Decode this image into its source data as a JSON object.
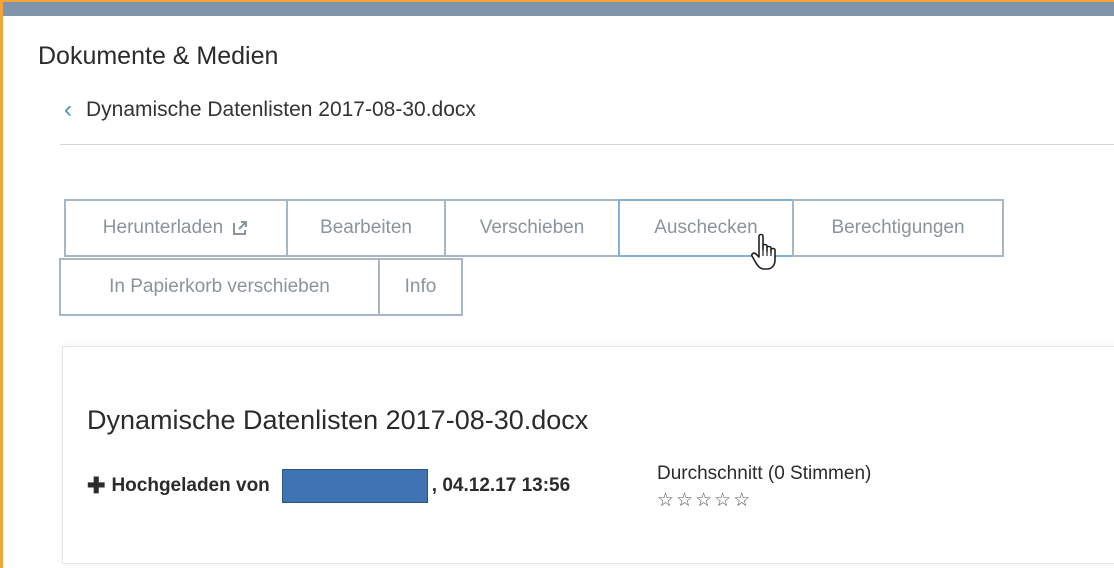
{
  "portlet": {
    "title": "Dokumente & Medien"
  },
  "navigation": {
    "back_label": "Dynamische Datenlisten 2017-08-30.docx"
  },
  "actions": {
    "row1": [
      "Herunterladen",
      "Bearbeiten",
      "Verschieben",
      "Auschecken",
      "Berechtigungen"
    ],
    "row2": [
      "In Papierkorb verschieben",
      "Info"
    ],
    "hovered": "Auschecken"
  },
  "document": {
    "title": "Dynamische Datenlisten 2017-08-30.docx",
    "uploaded_by_label": "Hochgeladen von",
    "uploaded_suffix": ", 04.12.17 13:56",
    "rating_label": "Durchschnitt (0 Stimmen)",
    "rating_value": 0,
    "rating_max": 5
  },
  "colors": {
    "top_bar": "#8094ac",
    "frame_accent": "#f3a43b",
    "button_border": "#a9b6c3",
    "button_hover_border": "#7fb2da",
    "redaction": "#3f73b2",
    "link_chevron": "#4a90c2"
  }
}
